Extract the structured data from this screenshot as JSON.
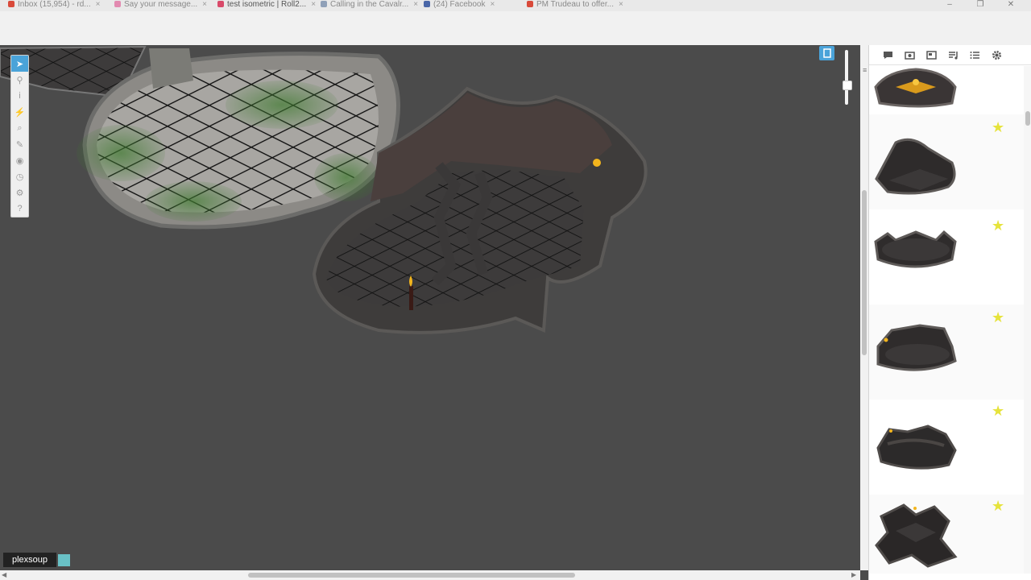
{
  "browser": {
    "tabs": [
      {
        "label": "Inbox (15,954) - rd...",
        "color": "#d94a3a"
      },
      {
        "label": "Say your message...",
        "color": "#e28ab0"
      },
      {
        "label": "test isometric | Roll2...",
        "color": "#d94a6a"
      },
      {
        "label": "Calling in the Cavalr...",
        "color": "#8fa0b8"
      },
      {
        "label": "(24) Facebook",
        "color": "#4a67a8"
      },
      {
        "label": "PM Trudeau to offer...",
        "color": "#d94a3a"
      }
    ],
    "window_controls": [
      "–",
      "❐",
      "✕"
    ]
  },
  "tools": [
    {
      "name": "select-tool",
      "glyph": "➤",
      "active": true
    },
    {
      "name": "pin-tool",
      "glyph": "⚲",
      "active": false
    },
    {
      "name": "info-tool",
      "glyph": "i",
      "active": false
    },
    {
      "name": "lightning-tool",
      "glyph": "⚡",
      "active": false
    },
    {
      "name": "zoom-tool",
      "glyph": "⚲",
      "active": false
    },
    {
      "name": "draw-tool",
      "glyph": "✎",
      "active": false
    },
    {
      "name": "fog-tool",
      "glyph": "◉",
      "active": false
    },
    {
      "name": "turn-tool",
      "glyph": "◷",
      "active": false
    },
    {
      "name": "dice-tool",
      "glyph": "⚙",
      "active": false
    },
    {
      "name": "help-tool",
      "glyph": "?",
      "active": false
    }
  ],
  "player": {
    "name": "plexsoup",
    "color": "#69c1c6"
  },
  "sidebar": {
    "tabs": [
      "chat-icon",
      "art-library-icon",
      "journal-icon",
      "jukebox-icon",
      "collections-icon",
      "settings-icon"
    ],
    "tiles": [
      {
        "favorite": false,
        "style": "fire"
      },
      {
        "favorite": true,
        "style": "cave-corner"
      },
      {
        "favorite": true,
        "style": "round-walls"
      },
      {
        "favorite": true,
        "style": "round-broken"
      },
      {
        "favorite": true,
        "style": "rock"
      },
      {
        "favorite": true,
        "style": "star-shape"
      }
    ],
    "star_glyph": "★"
  },
  "colors": {
    "accent": "#4aa3d9",
    "canvas": "#4b4b4b",
    "star": "#e6e33c"
  }
}
